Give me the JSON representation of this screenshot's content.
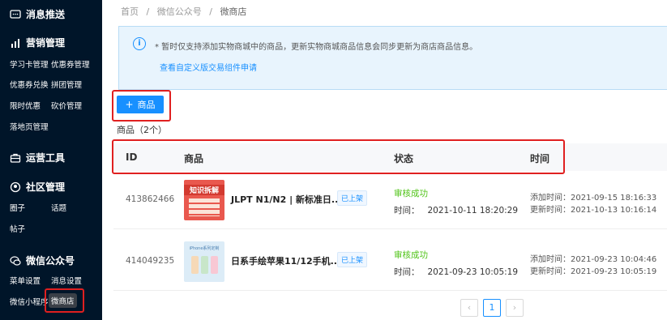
{
  "sidebar": {
    "sections": [
      {
        "label": "消息推送",
        "icon": "message-icon"
      },
      {
        "label": "营销管理",
        "icon": "chart-icon"
      },
      {
        "label": "运营工具",
        "icon": "toolbox-icon"
      },
      {
        "label": "社区管理",
        "icon": "community-icon"
      },
      {
        "label": "微信公众号",
        "icon": "wechat-icon"
      }
    ],
    "items": [
      "学习卡管理",
      "优惠券管理",
      "优惠券兑换",
      "拼团管理",
      "限时优惠",
      "砍价管理",
      "落地页管理",
      "圈子",
      "话题",
      "帖子",
      "菜单设置",
      "消息设置",
      "微信小程序",
      "微商店"
    ]
  },
  "breadcrumb": [
    "首页",
    "/",
    "微信公众号",
    "/",
    "微商店"
  ],
  "notice": {
    "icon": "info-icon",
    "text": "* 暂时仅支持添加实物商城中的商品，更新实物商城商品信息会同步更新为商店商品信息。",
    "link": "查看自定义版交易组件申请"
  },
  "add_button": {
    "icon": "plus-icon",
    "label": "商品"
  },
  "count_label": "商品（2个）",
  "table": {
    "headers": [
      "ID",
      "商品",
      "状态",
      "时间"
    ],
    "rows": [
      {
        "id": "413862466",
        "name": "JLPT N1/N2 | 新标准日...",
        "badge": "已上架",
        "status": "审核成功",
        "status_time_label": "时间：",
        "status_time": "2021-10-11 18:20:29",
        "added": "添加时间：2021-09-15 18:16:33",
        "updated": "更新时间：2021-10-13 10:16:14",
        "thumb_text": "知识拆解"
      },
      {
        "id": "414049235",
        "name": "日系手绘苹果11/12手机...",
        "badge": "已上架",
        "status": "审核成功",
        "status_time_label": "时间：",
        "status_time": "2021-09-23 10:05:19",
        "added": "添加时间：2021-09-23 10:04:46",
        "updated": "更新时间：2021-09-23 10:05:19",
        "thumb_text": "iPhone系列定制"
      }
    ]
  },
  "pagination": {
    "prev": "‹",
    "page": "1",
    "next": "›"
  },
  "colors": {
    "sidebar": "#001529",
    "accent": "#1890ff",
    "success": "#52c41a",
    "highlight": "#e02020"
  }
}
